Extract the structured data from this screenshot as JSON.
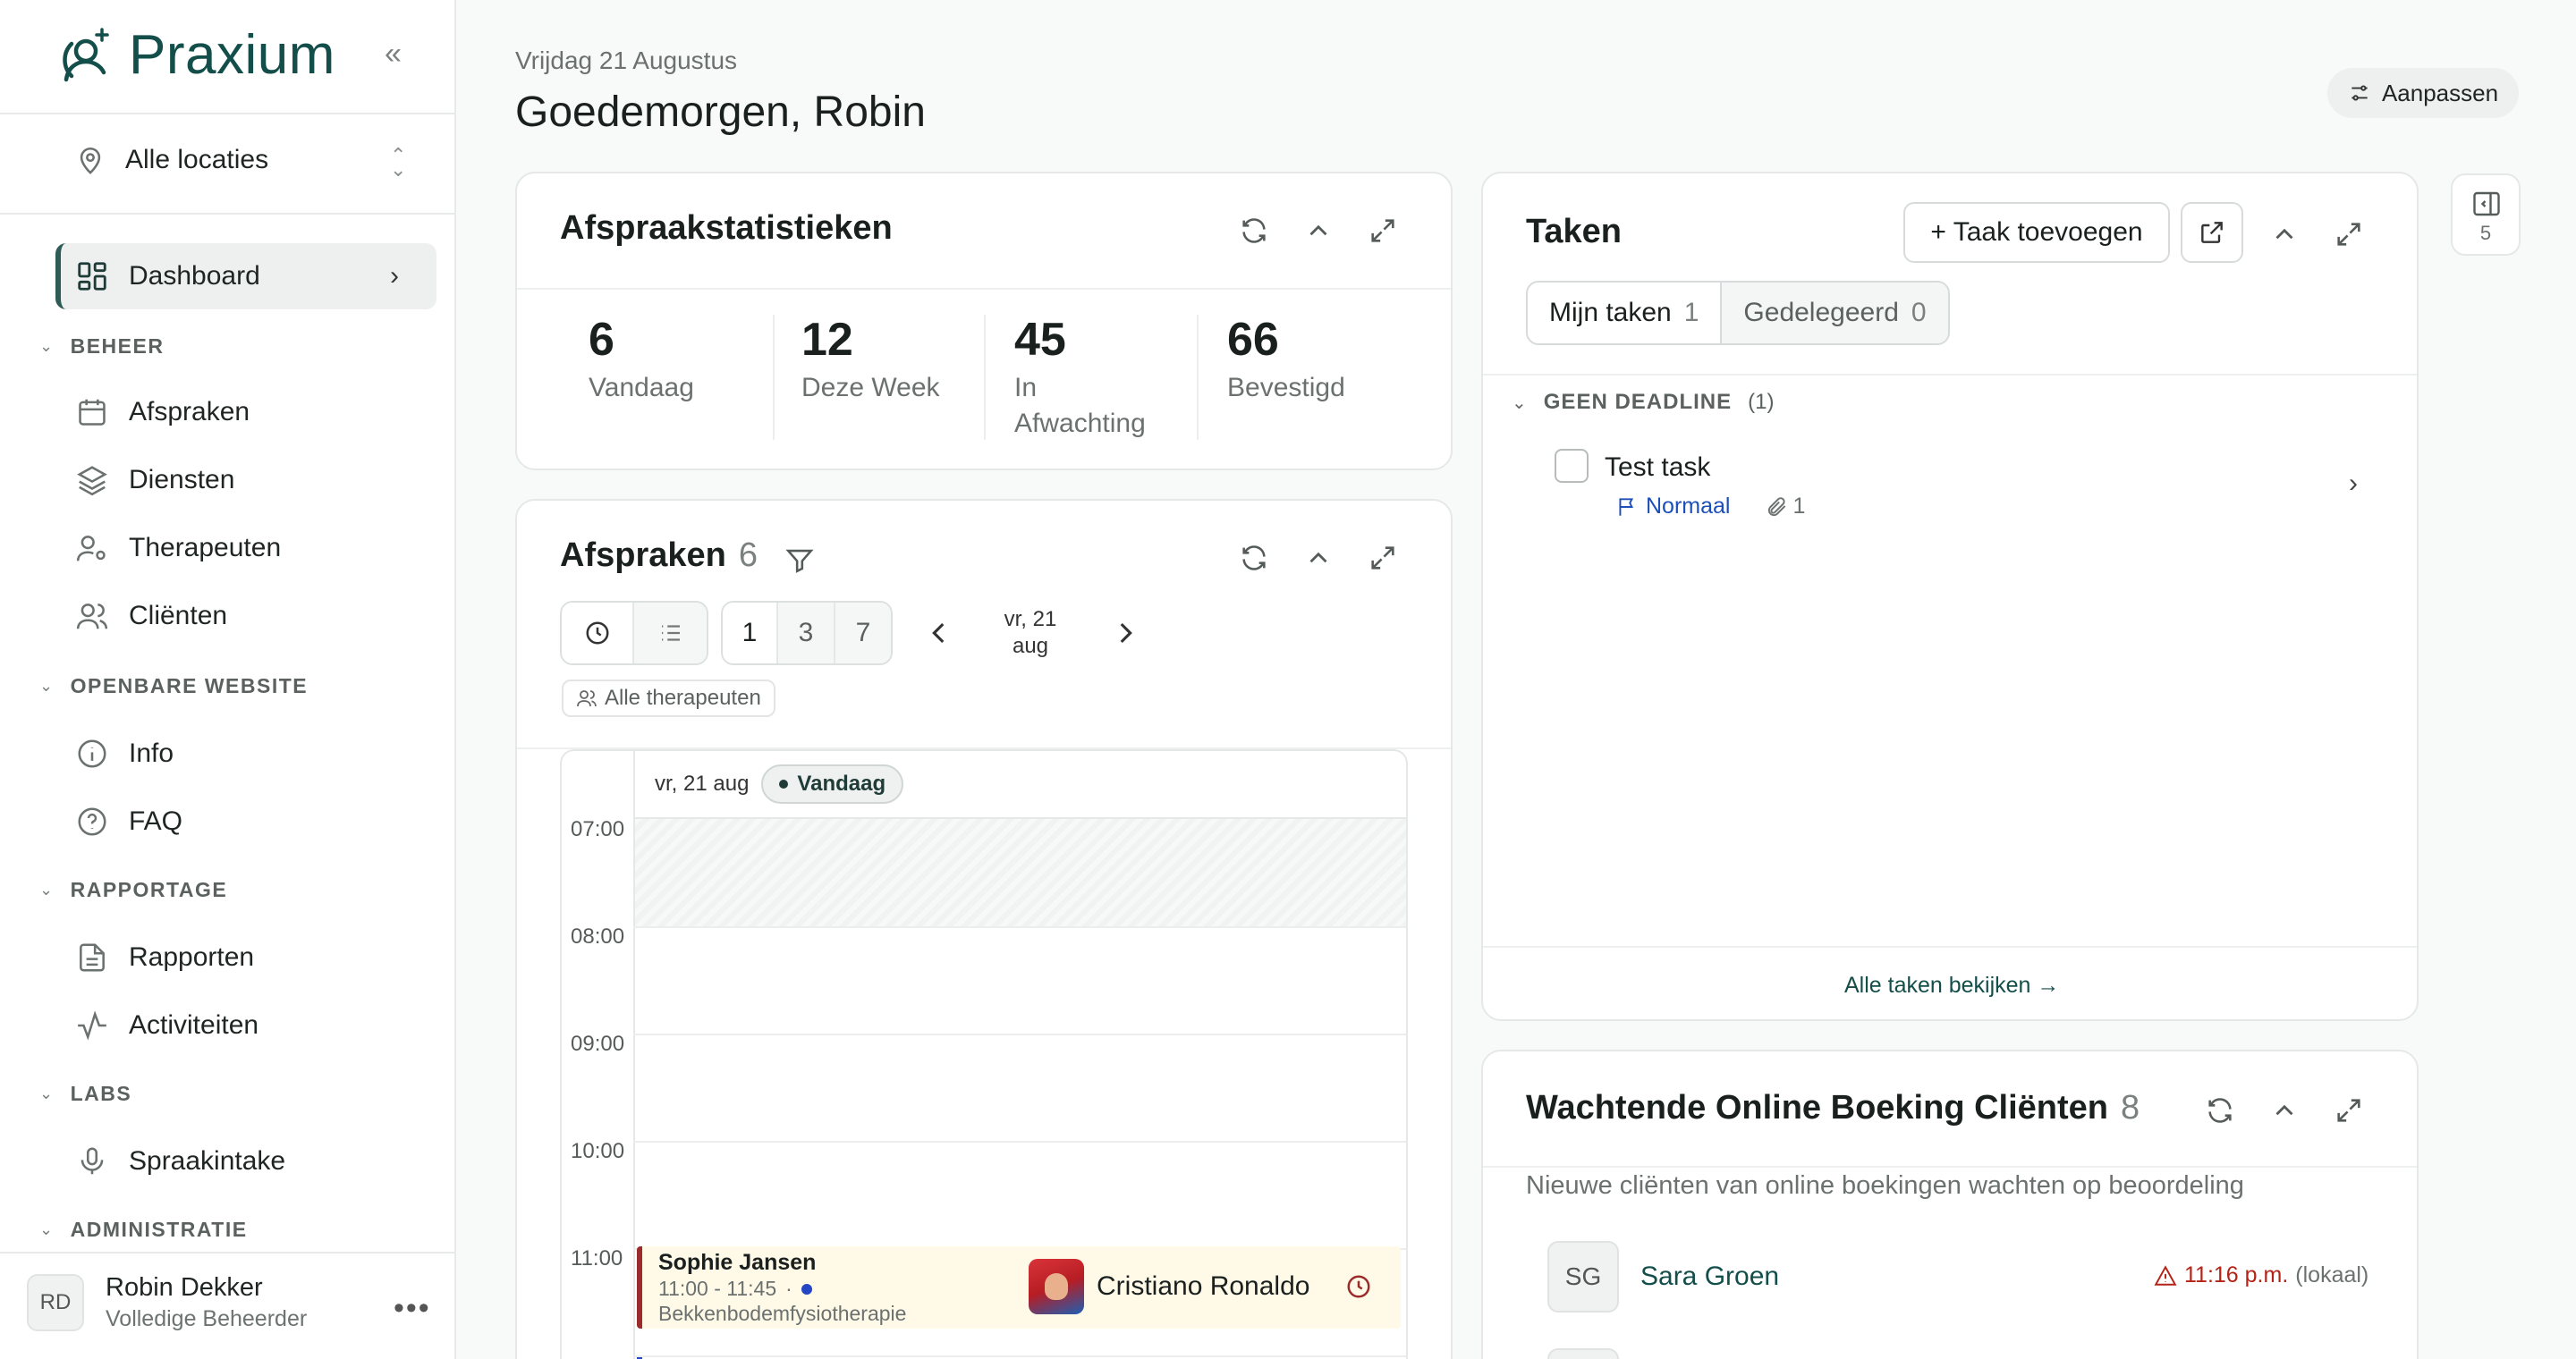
{
  "brand": {
    "name": "Praxium"
  },
  "sidebar": {
    "location": "Alle locaties",
    "nav": {
      "dashboard": "Dashboard",
      "sections": {
        "beheer": "BEHEER",
        "website": "OPENBARE WEBSITE",
        "rapportage": "RAPPORTAGE",
        "labs": "LABS",
        "admin": "ADMINISTRATIE"
      },
      "items": {
        "afspraken": "Afspraken",
        "diensten": "Diensten",
        "therapeuten": "Therapeuten",
        "clienten": "Cliënten",
        "info": "Info",
        "faq": "FAQ",
        "rapporten": "Rapporten",
        "activiteiten": "Activiteiten",
        "spraakintake": "Spraakintake"
      }
    },
    "user": {
      "initials": "RD",
      "name": "Robin Dekker",
      "role": "Volledige Beheerder"
    }
  },
  "header": {
    "date": "Vrijdag 21 Augustus",
    "greeting": "Goedemorgen, Robin",
    "customize": "Aanpassen"
  },
  "stats": {
    "title": "Afspraakstatistieken",
    "items": [
      {
        "value": "6",
        "label": "Vandaag"
      },
      {
        "value": "12",
        "label": "Deze Week"
      },
      {
        "value": "45",
        "label": "In Afwachting"
      },
      {
        "value": "66",
        "label": "Bevestigd"
      }
    ]
  },
  "appointments": {
    "title": "Afspraken",
    "count": "6",
    "days": [
      "1",
      "3",
      "7"
    ],
    "nav_date_line1": "vr, 21",
    "nav_date_line2": "aug",
    "filter_chip": "Alle therapeuten",
    "calendar": {
      "day_label": "vr, 21 aug",
      "today": "Vandaag",
      "hours": [
        "07:00",
        "08:00",
        "09:00",
        "10:00",
        "11:00"
      ]
    },
    "event": {
      "client": "Sophie Jansen",
      "time": "11:00 - 11:45",
      "separator": "·",
      "service": "Bekkenbodemfysiotherapie",
      "therapist": "Cristiano Ronaldo"
    }
  },
  "tasks": {
    "title": "Taken",
    "add": "+ Taak toevoegen",
    "tabs": [
      {
        "label": "Mijn taken",
        "count": "1"
      },
      {
        "label": "Gedelegeerd",
        "count": "0"
      }
    ],
    "group": {
      "label": "GEEN DEADLINE",
      "count": "(1)"
    },
    "items": [
      {
        "title": "Test task",
        "priority": "Normaal",
        "attachments": "1"
      }
    ],
    "view_all": "Alle taken bekijken →"
  },
  "waiting": {
    "title": "Wachtende Online Boeking Cliënten",
    "count": "8",
    "subtitle": "Nieuwe cliënten van online boekingen wachten op beoordeling",
    "clients": [
      {
        "initials": "SG",
        "name": "Sara Groen",
        "time": "11:16 p.m.",
        "suffix": "(lokaal)"
      }
    ]
  },
  "rail": {
    "count": "5"
  }
}
